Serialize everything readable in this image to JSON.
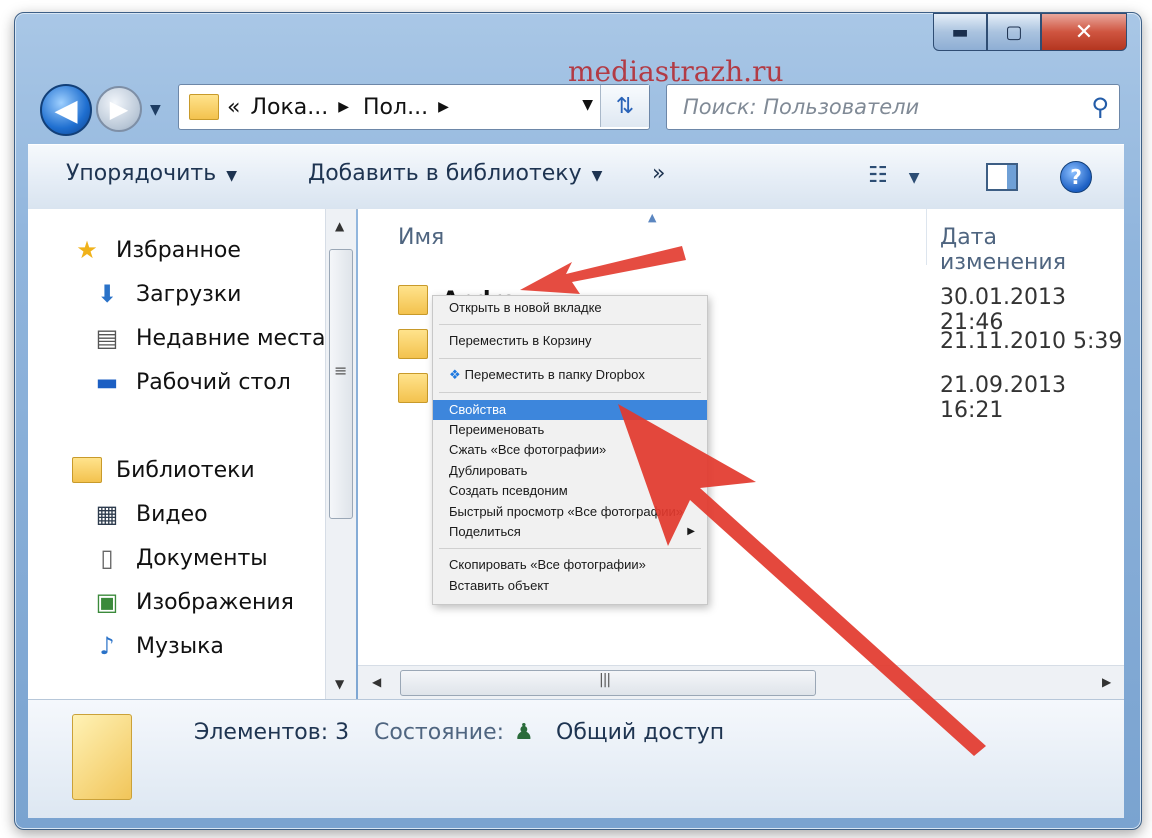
{
  "watermark": "mediastrazh.ru",
  "window": {
    "buttons": {
      "minimize": "▬",
      "maximize": "▢",
      "close": "✕"
    }
  },
  "nav": {
    "back": "◀",
    "forward": "▶"
  },
  "address": {
    "prefix": "«",
    "crumbs": [
      "Лока...",
      "Пол..."
    ]
  },
  "search": {
    "placeholder": "Поиск: Пользователи"
  },
  "toolbar": {
    "organize": "Упорядочить",
    "add_library": "Добавить в библиотеку",
    "more": "»"
  },
  "sidebar": {
    "favorites": {
      "title": "Избранное",
      "items": [
        "Загрузки",
        "Недавние места",
        "Рабочий стол"
      ]
    },
    "libraries": {
      "title": "Библиотеки",
      "items": [
        "Видео",
        "Документы",
        "Изображения",
        "Музыка"
      ]
    }
  },
  "columns": {
    "name": "Имя",
    "date": "Дата изменения"
  },
  "files": [
    {
      "name": "Andrey",
      "date": "30.01.2013 21:46"
    },
    {
      "name": "",
      "date": "21.11.2010 5:39"
    },
    {
      "name": "",
      "date": "21.09.2013 16:21"
    }
  ],
  "context_menu": {
    "items": [
      "Открыть в новой вкладке",
      "Переместить в Корзину",
      "Переместить в папку Dropbox",
      "Свойства",
      "Переименовать",
      "Сжать «Все фотографии»",
      "Дублировать",
      "Создать псевдоним",
      "Быстрый просмотр «Все фотографии»",
      "Поделиться",
      "Скопировать «Все фотографии»",
      "Вставить объект"
    ],
    "selected": "Свойства"
  },
  "details": {
    "items_count": "Элементов: 3",
    "state_label": "Состояние:",
    "state_value": "Общий доступ"
  },
  "colors": {
    "arrow": "#e2382c",
    "selection": "#3d86dc"
  }
}
